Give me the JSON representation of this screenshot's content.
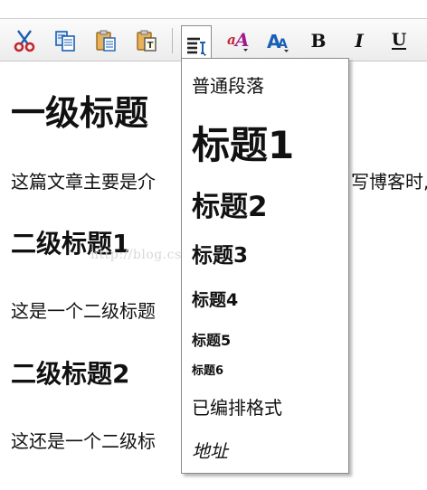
{
  "toolbar": {
    "buttons": [
      {
        "icon": "cut-icon"
      },
      {
        "icon": "copy-icon"
      },
      {
        "icon": "paste-icon"
      },
      {
        "icon": "paste-text-icon"
      },
      {
        "icon": "format-block-icon"
      },
      {
        "icon": "remove-format-icon"
      },
      {
        "icon": "font-size-icon"
      },
      {
        "icon": "bold-icon",
        "label": "B"
      },
      {
        "icon": "italic-icon",
        "label": "I"
      },
      {
        "icon": "underline-icon",
        "label": "U"
      }
    ]
  },
  "content": {
    "heading1": "一级标题",
    "paragraph1": "这篇文章主要是介",
    "paragraph1_tail": "写博客时,",
    "heading2a": "二级标题1",
    "paragraph2": "这是一个二级标题",
    "heading2b": "二级标题2",
    "paragraph3": "这还是一个二级标",
    "watermark": "http://blog.csdn.net/TuGeLe"
  },
  "format_menu": {
    "items": [
      {
        "label": "普通段落"
      },
      {
        "label": "标题1"
      },
      {
        "label": "标题2"
      },
      {
        "label": "标题3"
      },
      {
        "label": "标题4"
      },
      {
        "label": "标题5"
      },
      {
        "label": "标题6"
      },
      {
        "label": "已编排格式"
      },
      {
        "label": "地址"
      }
    ]
  },
  "colors": {
    "toolbar_bg": "#ececec",
    "border": "#8b8b8b",
    "text": "#111111",
    "icon_blue": "#1a5fb4",
    "icon_red": "#c4262e",
    "icon_magenta": "#a01a8a"
  }
}
